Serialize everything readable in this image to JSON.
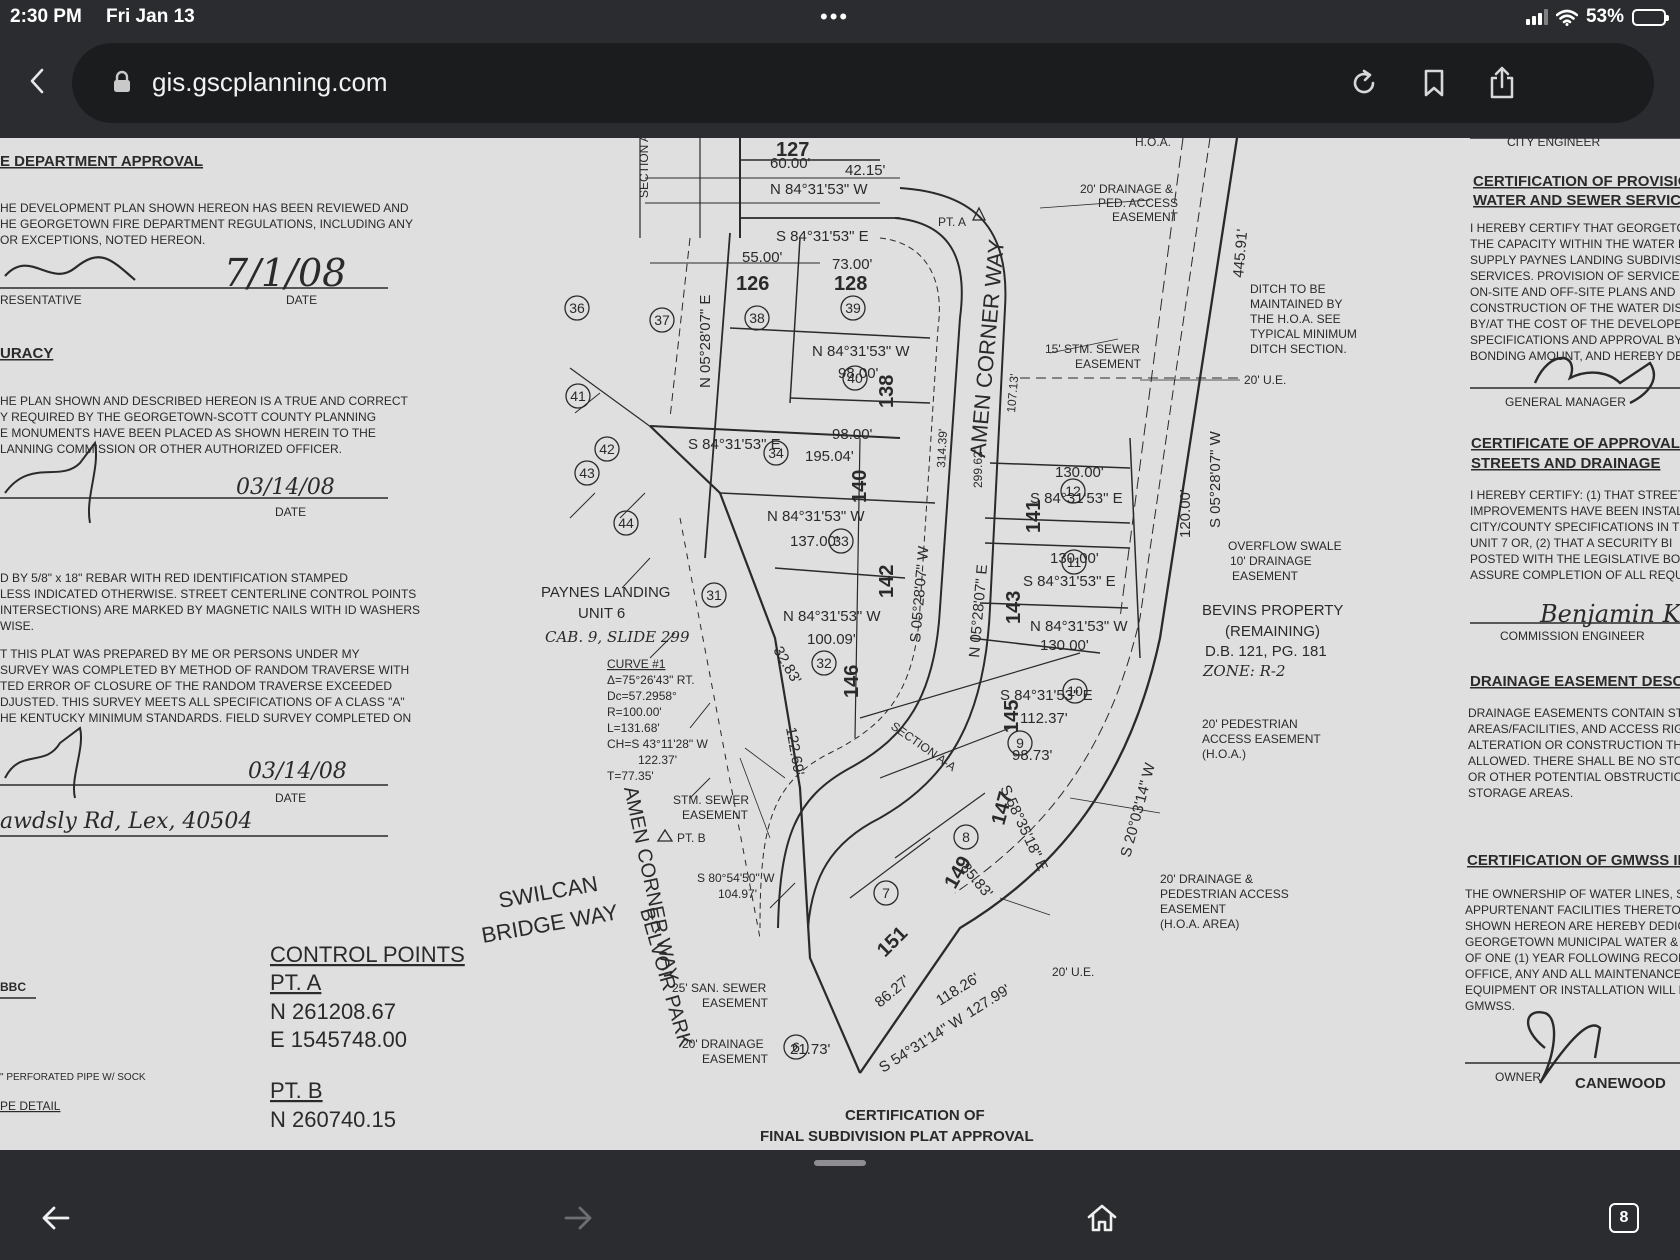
{
  "status_bar": {
    "time": "2:30 PM",
    "date": "Fri Jan 13",
    "battery": "53%",
    "battery_level": 0.53,
    "multitask_dots": "•••"
  },
  "browser": {
    "url": "gis.gscplanning.com",
    "tab_count": "8"
  },
  "icons": {
    "back": "chevron-left-icon",
    "lock": "lock-icon",
    "reload": "reload-icon",
    "bookmark": "bookmark-icon",
    "share": "share-icon",
    "nav_back": "arrow-left-icon",
    "nav_forward": "arrow-right-icon",
    "home": "home-icon",
    "tabs": "tabs-icon"
  },
  "plat": {
    "left": {
      "heading1": "E DEPARTMENT APPROVAL",
      "fire_text": [
        "HE DEVELOPMENT PLAN SHOWN HEREON HAS BEEN REVIEWED AND",
        "HE GEORGETOWN FIRE DEPARTMENT REGULATIONS, INCLUDING ANY",
        "OR EXCEPTIONS, NOTED HEREON."
      ],
      "date1": "7/1/08",
      "representative": "RESENTATIVE",
      "date_label": "DATE",
      "heading2": "URACY",
      "accuracy_text": [
        "HE PLAN SHOWN AND DESCRIBED HEREON IS A TRUE AND CORRECT",
        "Y REQUIRED BY THE GEORGETOWN-SCOTT COUNTY PLANNING",
        "E MONUMENTS HAVE BEEN PLACED AS SHOWN HEREIN TO THE",
        "LANNING COMMISSION OR OTHER AUTHORIZED OFFICER."
      ],
      "date2": "03/14/08",
      "rebar_text": [
        "D BY 5/8\" x 18\" REBAR WITH RED IDENTIFICATION STAMPED",
        "LESS INDICATED OTHERWISE. STREET CENTERLINE CONTROL POINTS",
        "INTERSECTIONS) ARE MARKED BY MAGNETIC NAILS WITH ID WASHERS",
        "WISE."
      ],
      "survey_text": [
        "T THIS PLAT WAS PREPARED BY ME OR PERSONS UNDER MY",
        "SURVEY WAS COMPLETED BY METHOD OF RANDOM TRAVERSE WITH",
        "TED ERROR OF CLOSURE OF THE RANDOM TRAVERSE EXCEEDED",
        "DJUSTED. THIS SURVEY MEETS ALL SPECIFICATIONS OF A CLASS \"A\"",
        "HE KENTUCKY MINIMUM STANDARDS. FIELD SURVEY COMPLETED ON"
      ],
      "date3": "03/14/08",
      "address_script": "awdsly Rd, Lex, 40504",
      "control_points_title": "CONTROL POINTS",
      "pt_a_label": "PT. A",
      "pt_a_n": "N  261208.67",
      "pt_a_e": "E  1545748.00",
      "pt_b_label": "PT. B",
      "pt_b_n": "N  260740.15",
      "pipe_note": "\" PERFORATED PIPE W/ SOCK",
      "pipe_detail": "PE DETAIL",
      "bbc": "BBC"
    },
    "center": {
      "paynes_landing": "PAYNES LANDING",
      "unit6": "UNIT 6",
      "cab": "CAB. 9, SLIDE 299",
      "curve_title": "CURVE #1",
      "curve_lines": [
        "Δ=75°26'43\" RT.",
        "Dc=57.2958°",
        "R=100.00'",
        "L=131.68'",
        "CH=S 43°11'28\" W",
        "122.37'",
        "T=77.35'"
      ],
      "swilcan": "SWILCAN",
      "bridge_way": "BRIDGE WAY",
      "amen_corner_way": "AMEN CORNER WAY",
      "belvoir_park": "BELVOIR PARK",
      "section_aa": "SECTION A-A",
      "bevins": "BEVINS PROPERTY",
      "remaining": "(REMAINING)",
      "db": "D.B. 121, PG. 181",
      "zone": "ZONE: R-2",
      "ditch_note": [
        "DITCH TO BE",
        "MAINTAINED BY",
        "THE H.O.A. SEE",
        "TYPICAL MINIMUM",
        "DITCH SECTION."
      ],
      "drainage_ped": [
        "20' DRAINAGE &",
        "PED. ACCESS",
        "EASEMENT"
      ],
      "stm_sewer": [
        "15' STM. SEWER",
        "EASEMENT"
      ],
      "ue20": "20' U.E.",
      "overflow": [
        "OVERFLOW SWALE",
        "10' DRAINAGE",
        "EASEMENT"
      ],
      "ped_access": [
        "20' PEDESTRIAN",
        "ACCESS EASEMENT",
        "(H.O.A.)"
      ],
      "drainage_ped2": [
        "20' DRAINAGE &",
        "PEDESTRIAN ACCESS",
        "EASEMENT",
        "(H.O.A. AREA)"
      ],
      "san_sewer_25": [
        "25' SAN. SEWER",
        "EASEMENT"
      ],
      "drainage_20": [
        "20' DRAINAGE",
        "EASEMENT"
      ],
      "stm_sewer2": [
        "STM. SEWER",
        "EASEMENT"
      ],
      "cert_bottom1": "CERTIFICATION OF",
      "cert_bottom2": "FINAL SUBDIVISION PLAT APPROVAL",
      "hoa": "H.O.A.",
      "pt_a": "PT. A",
      "pt_b": "PT. B",
      "lots": [
        "127",
        "126",
        "128",
        "138",
        "140",
        "141",
        "142",
        "143",
        "145",
        "146",
        "147",
        "149",
        "151"
      ],
      "circled": [
        "36",
        "37",
        "38",
        "39",
        "40",
        "41",
        "42",
        "43",
        "44",
        "34",
        "33",
        "32",
        "31",
        "12",
        "11",
        "10",
        "9",
        "8",
        "7",
        "6"
      ],
      "bearings": [
        "N 84°31'53\" W",
        "S 84°31'53\" E",
        "N 05°28'07\" E",
        "S 05°28'07\" W",
        "S 20°03'14\" W",
        "S 58°35'18\" E",
        "S 54°31'14\" W",
        "S 80°54'50\" W"
      ],
      "distances": [
        "60.00'",
        "42.15'",
        "55.00'",
        "73.00'",
        "98.00'",
        "195.04'",
        "137.00'",
        "100.09'",
        "130.00'",
        "120.00'",
        "445.91'",
        "299.62'",
        "314.39'",
        "107.13'",
        "118.26'",
        "127.99'",
        "86.27'",
        "85.83'",
        "98.73'",
        "112.37'",
        "32.83'",
        "122.69'",
        "21.73'",
        "104.97'"
      ]
    },
    "right": {
      "city_engineer": "CITY ENGINEER",
      "cert_provision1": "CERTIFICATION OF PROVISION",
      "cert_provision2": "WATER AND SEWER SERVICE",
      "provision_text": [
        "I HEREBY CERTIFY THAT GEORGETOW",
        "THE CAPACITY WITHIN THE WATER D",
        "SUPPLY PAYNES LANDING SUBDIVISI",
        "SERVICES. PROVISION OF SERVICE W",
        "ON-SITE AND OFF-SITE PLANS AND",
        "CONSTRUCTION OF THE WATER DISTR",
        "BY/AT THE COST OF THE DEVELOPE",
        "SPECIFICATIONS AND APPROVAL BY",
        "BONDING AMOUNT, AND HEREBY DED"
      ],
      "general_manager": "GENERAL MANAGER",
      "cert_approval1": "CERTIFICATE OF APPROVAL OF",
      "cert_approval2": "STREETS AND DRAINAGE",
      "approval_text": [
        "I HEREBY CERTIFY: (1) THAT STREET",
        "IMPROVEMENTS HAVE BEEN INSTALLE",
        "CITY/COUNTY SPECIFICATIONS IN THE",
        "UNIT 7 OR, (2) THAT A SECURITY BI",
        "POSTED WITH THE LEGISLATIVE BODY",
        "ASSURE COMPLETION OF ALL REQUIR"
      ],
      "signature_benjamin": "Benjamin K.",
      "commission_engineer": "COMMISSION ENGINEER",
      "drainage_heading": "DRAINAGE EASEMENT DESCRIP",
      "drainage_text": [
        "DRAINAGE EASEMENTS CONTAIN STOR",
        "AREAS/FACILITIES, AND ACCESS RIGH",
        "ALTERATION OR CONSTRUCTION THAT",
        "ALLOWED. THERE SHALL BE NO STOR",
        "OR OTHER POTENTIAL OBSTRUCTIONS",
        "STORAGE AREAS."
      ],
      "gmwss_heading": "CERTIFICATION OF GMWSS INFR",
      "gmwss_text": [
        "THE OWNERSHIP OF WATER LINES, SE",
        "APPURTENANT FACILITIES THERETO EX",
        "SHOWN HEREON ARE HEREBY DEDICA",
        "GEORGETOWN MUNICIPAL WATER & SE",
        "OF ONE (1) YEAR FOLLOWING RECORD",
        "OFFICE, ANY AND ALL MAINTENANCE",
        "EQUIPMENT OR INSTALLATION WILL BE",
        "GMWSS."
      ],
      "owner": "OWNER",
      "owner_sig": "CANEWOOD"
    }
  },
  "colors": {
    "chrome": "#2b2c2f",
    "url_field": "#1b1c1e",
    "paper": "#dfdfdf",
    "ink": "#2a2a2a"
  }
}
